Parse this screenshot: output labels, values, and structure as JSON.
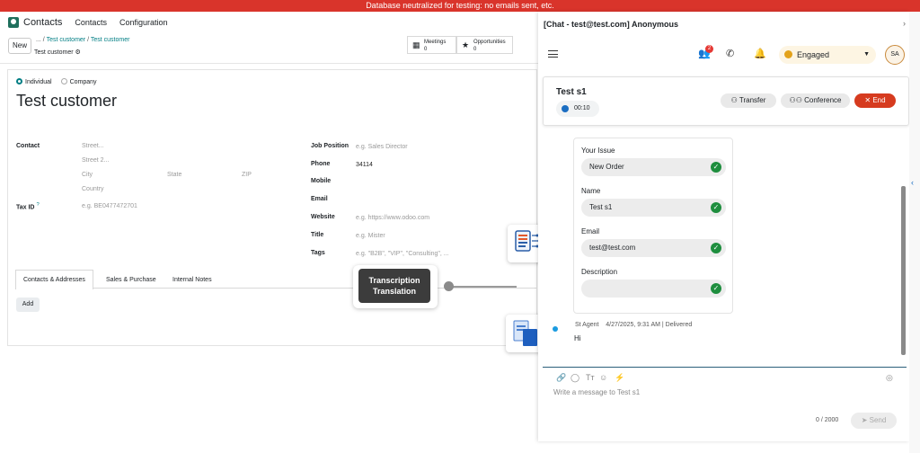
{
  "banner": "Database neutralized for testing: no emails sent, etc.",
  "topnav": {
    "app": "Contacts",
    "links": [
      "Contacts",
      "Configuration"
    ]
  },
  "control": {
    "new_label": "New",
    "breadcrumb": [
      "...",
      "Test customer",
      "Test customer"
    ],
    "record_name": "Test customer",
    "meetings_label": "Meetings",
    "meetings_count": "0",
    "opportunities_label": "Opportunities",
    "opportunities_count": "0"
  },
  "form": {
    "type_options": [
      "Individual",
      "Company"
    ],
    "type_selected": "Individual",
    "name": "Test customer",
    "contact_label": "Contact",
    "street_ph": "Street...",
    "street2_ph": "Street 2...",
    "city_ph": "City",
    "state_ph": "State",
    "zip_ph": "ZIP",
    "country_ph": "Country",
    "taxid_label": "Tax ID",
    "taxid_help": "?",
    "taxid_ph": "e.g. BE0477472701",
    "job_label": "Job Position",
    "job_ph": "e.g. Sales Director",
    "phone_label": "Phone",
    "phone_value": "34114",
    "mobile_label": "Mobile",
    "email_label": "Email",
    "website_label": "Website",
    "website_ph": "e.g. https://www.odoo.com",
    "title_label": "Title",
    "title_ph": "e.g. Mister",
    "tags_label": "Tags",
    "tags_ph": "e.g. \"B2B\", \"VIP\", \"Consulting\", ..."
  },
  "tabs": [
    "Contacts & Addresses",
    "Sales & Purchase",
    "Internal Notes"
  ],
  "add_label": "Add",
  "overlay": {
    "line1": "Transcription",
    "line2": "Translation"
  },
  "chat": {
    "title": "[Chat - test@test.com] Anonymous",
    "notif_count": "2",
    "status": "Engaged",
    "avatar": "SA",
    "contact_name": "Test s1",
    "timer": "00:10",
    "transfer": "Transfer",
    "conference": "Conference",
    "end": "End",
    "fields": [
      {
        "label": "Your Issue",
        "value": "New Order"
      },
      {
        "label": "Name",
        "value": "Test s1"
      },
      {
        "label": "Email",
        "value": "test@test.com"
      },
      {
        "label": "Description",
        "value": ""
      }
    ],
    "msg_meta": "St Agent    4/27/2025, 9:31 AM | Delivered",
    "msg_text": "Hi",
    "compose_ph": "Write a message to Test s1",
    "char_count": "0 / 2000",
    "send": "Send"
  }
}
